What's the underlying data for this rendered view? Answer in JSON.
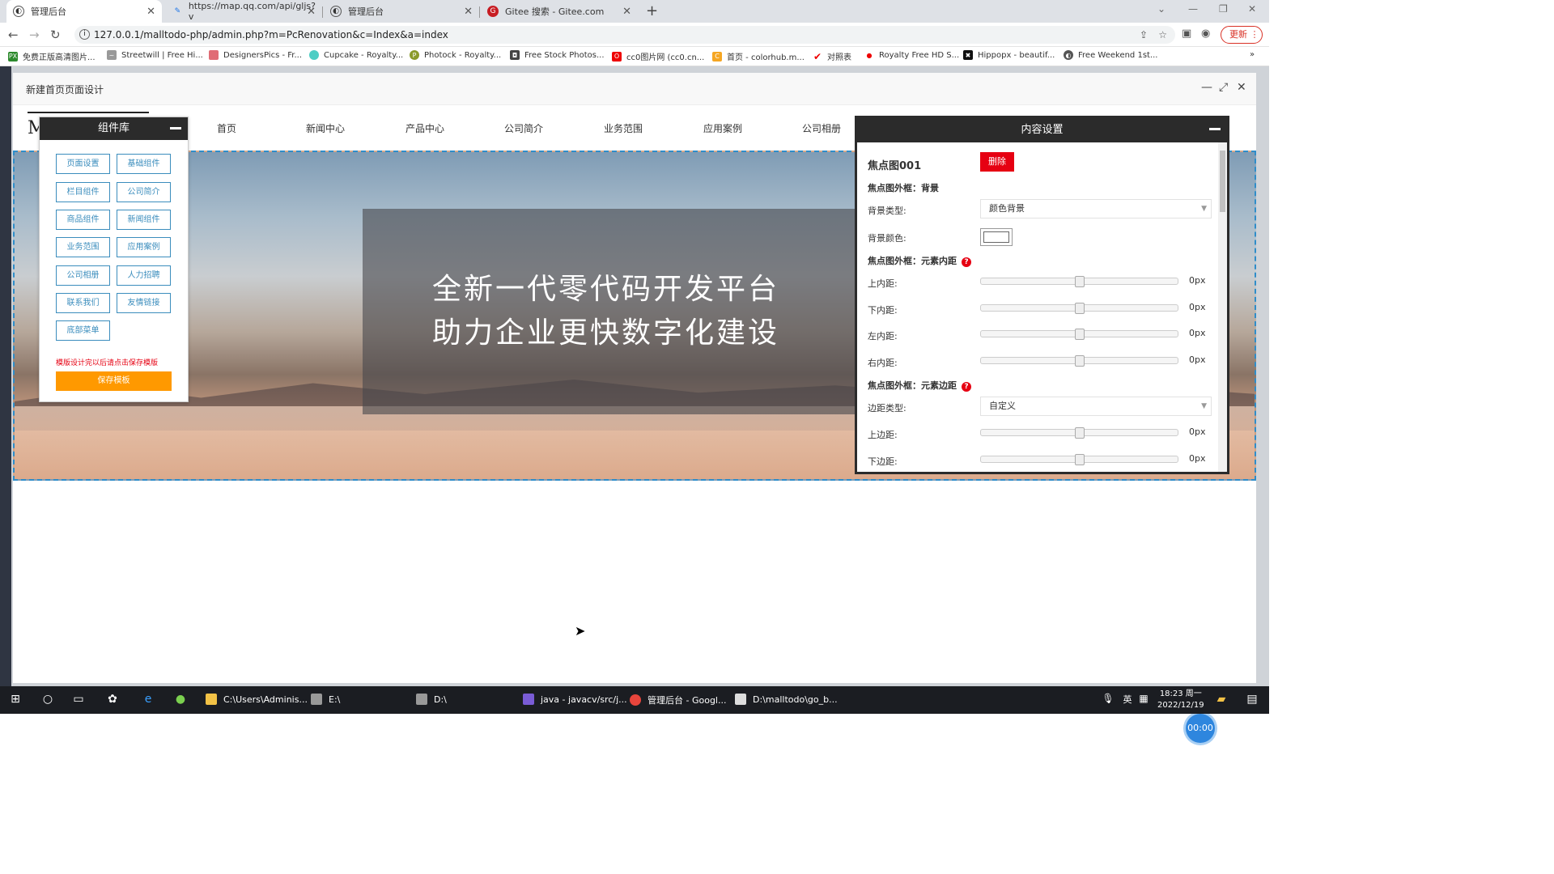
{
  "browser": {
    "tabs": [
      {
        "label": "管理后台",
        "active": true
      },
      {
        "label": "https://map.qq.com/api/gljs?v",
        "active": false
      },
      {
        "label": "管理后台",
        "active": false
      },
      {
        "label": "Gitee 搜索 - Gitee.com",
        "active": false
      }
    ],
    "url": "127.0.0.1/malltodo-php/admin.php?m=PcRenovation&c=Index&a=index",
    "update_label": "更新",
    "bookmarks": [
      "免费正版高清图片...",
      "Streetwill | Free Hi...",
      "DesignersPics - Fr...",
      "Cupcake - Royalty...",
      "Photock - Royalty...",
      "Free Stock Photos...",
      "cc0图片网 (cc0.cn...",
      "首页 - colorhub.m...",
      "对照表",
      "Royalty Free HD S...",
      "Hippopx - beautif...",
      "Free Weekend 1st..."
    ]
  },
  "modal": {
    "title": "新建首页页面设计"
  },
  "site": {
    "nav": [
      "首页",
      "新闻中心",
      "产品中心",
      "公司简介",
      "业务范围",
      "应用案例",
      "公司相册"
    ],
    "logo_text": "M",
    "hero_line1": "全新一代零代码开发平台",
    "hero_line2": "助力企业更快数字化建设"
  },
  "component_library": {
    "title": "组件库",
    "buttons": [
      "页面设置",
      "基础组件",
      "栏目组件",
      "公司简介",
      "商品组件",
      "新闻组件",
      "业务范围",
      "应用案例",
      "公司相册",
      "人力招聘",
      "联系我们",
      "友情链接",
      "底部菜单"
    ],
    "tip": "模版设计完以后请点击保存模版",
    "save_label": "保存模板"
  },
  "content_settings": {
    "title": "内容设置",
    "element_name": "焦点图001",
    "delete_label": "删除",
    "section_bg": "焦点图外框：背景",
    "bg_type_label": "背景类型:",
    "bg_type_value": "颜色背景",
    "bg_color_label": "背景颜色:",
    "section_padding": "焦点图外框：元素内距",
    "padding_rows": [
      {
        "label": "上内距:",
        "value": "0px"
      },
      {
        "label": "下内距:",
        "value": "0px"
      },
      {
        "label": "左内距:",
        "value": "0px"
      },
      {
        "label": "右内距:",
        "value": "0px"
      }
    ],
    "section_margin": "焦点图外框：元素边距",
    "margin_type_label": "边距类型:",
    "margin_type_value": "自定义",
    "margin_rows": [
      {
        "label": "上边距:",
        "value": "0px"
      },
      {
        "label": "下边距:",
        "value": "0px"
      }
    ]
  },
  "timer": "00:00",
  "taskbar": {
    "items": [
      "C:\\Users\\Adminis...",
      "E:\\",
      "D:\\",
      "java - javacv/src/j...",
      "管理后台 - Googl...",
      "D:\\malltodo\\go_b..."
    ],
    "time": "18:23 周一",
    "date": "2022/12/19",
    "ime": "英"
  },
  "colors": {
    "accent": "#3b8dbd",
    "danger": "#e60012",
    "save": "#ff9900",
    "panel_header": "#2b2b2b"
  }
}
